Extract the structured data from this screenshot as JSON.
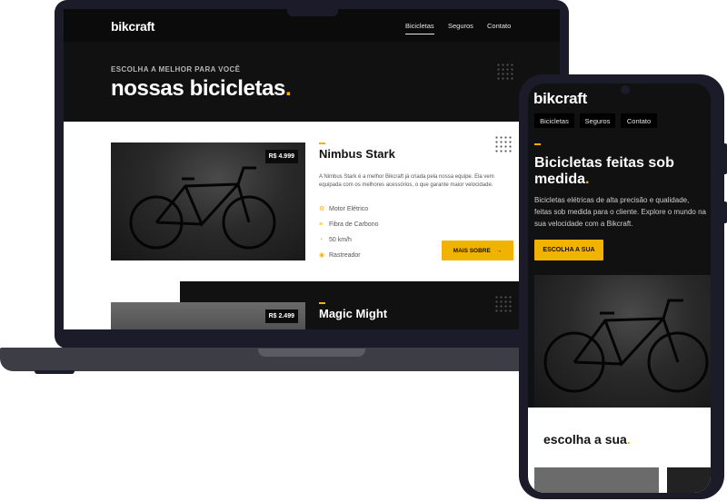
{
  "site": {
    "logo": "bikcraft",
    "nav": [
      {
        "label": "Bicicletas",
        "active": true
      },
      {
        "label": "Seguros",
        "active": false
      },
      {
        "label": "Contato",
        "active": false
      }
    ],
    "accent": "#f2b300"
  },
  "laptop": {
    "hero_sub": "ESCOLHA A MELHOR PARA VOCÊ",
    "hero_title": "nossas bicicletas",
    "hero_dot": ".",
    "products": [
      {
        "name": "Nimbus Stark",
        "price": "R$ 4.999",
        "description": "A Nimbus Stark é a melhor Bikcraft já criada pela nossa equipe. Ela vem equipada com os melhores acessórios, o que garante maior velocidade.",
        "features": [
          {
            "icon": "motor-icon",
            "label": "Motor Elétrico"
          },
          {
            "icon": "fiber-icon",
            "label": "Fibra de Carbono"
          },
          {
            "icon": "speed-icon",
            "label": "50 km/h"
          },
          {
            "icon": "tracker-icon",
            "label": "Rastreador"
          }
        ],
        "button": "MAIS SOBRE",
        "button_arrow": "→"
      },
      {
        "name": "Magic Might",
        "price": "R$ 2.499"
      }
    ]
  },
  "phone": {
    "logo": "bikcraft",
    "nav": [
      "Bicicletas",
      "Seguros",
      "Contato"
    ],
    "title": "Bicicletas feitas sob medida",
    "title_dot": ".",
    "description": "Bicicletas elétricas de alta precisão e qualidade, feitas sob medida para o cliente. Explore o mundo na sua velocidade com a Bikcraft.",
    "button": "ESCOLHA A SUA",
    "section_title": "escolha a sua",
    "section_dot": "."
  }
}
